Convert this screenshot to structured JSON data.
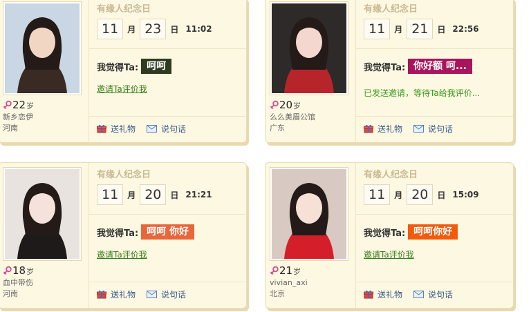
{
  "labels": {
    "anniversary": "有缘人纪念日",
    "month_unit": "月",
    "day_unit": "日",
    "feel_label": "我觉得Ta:",
    "invite": "邀请Ta评价我",
    "gift": "送礼物",
    "message": "说句话",
    "age_unit": "岁"
  },
  "colors": {
    "card_bg": "#fdf8e2",
    "anniversary_text": "#c9b993",
    "link_green": "#3a7d1c",
    "female_icon": "#d24c8e"
  },
  "cards": [
    {
      "age": "22",
      "nickname": "新乡恋伊",
      "city": "河南",
      "month": "11",
      "day": "23",
      "time": "11:02",
      "feel": "呵呵",
      "feel_color": "#2f3b1f",
      "status": "",
      "action": "invite"
    },
    {
      "age": "20",
      "nickname": "么么美眉公馆",
      "city": "广东",
      "month": "11",
      "day": "21",
      "time": "22:56",
      "feel": "你好额 呵...",
      "feel_color": "#a8155c",
      "status": "已发送邀请，等待Ta给我评价...",
      "action": "status"
    },
    {
      "age": "18",
      "nickname": "血中带伤",
      "city": "河南",
      "month": "11",
      "day": "20",
      "time": "21:21",
      "feel": "呵呵 你好",
      "feel_color": "#e8663a",
      "status": "",
      "action": "invite"
    },
    {
      "age": "21",
      "nickname": "vivian_axi",
      "city": "北京",
      "month": "11",
      "day": "20",
      "time": "15:09",
      "feel": "呵呵你好",
      "feel_color": "#f25a0c",
      "status": "",
      "action": "invite"
    }
  ]
}
